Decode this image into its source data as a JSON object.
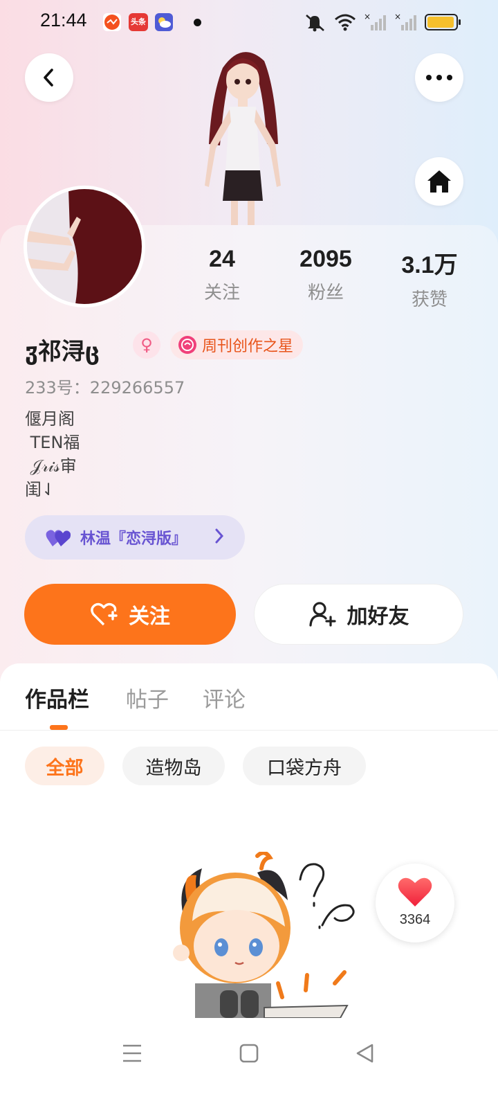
{
  "status_bar": {
    "time": "21:44",
    "notification_icons": [
      "sports-app-icon",
      "toutiao-app-icon",
      "weather-app-icon"
    ],
    "toutiao_label": "头条",
    "system_icons": [
      "mute-icon",
      "wifi-icon",
      "signal-1-icon",
      "signal-2-icon",
      "battery-icon"
    ]
  },
  "header": {
    "back_icon": "chevron-left-icon",
    "more_icon": "more-dots-icon",
    "home_icon": "home-icon"
  },
  "profile": {
    "stats": [
      {
        "value": "24",
        "label": "关注"
      },
      {
        "value": "2095",
        "label": "粉丝"
      },
      {
        "value": "3.1万",
        "label": "获赞"
      }
    ],
    "name": "ჳ祁浔ც",
    "gender_symbol": "♀",
    "badge_label": "周刊创作之星",
    "uid": "233号：229266557",
    "bio": "偃月阁\n TEN福\n 𝒥𝓇𝒾𝓈审\n闺⇃",
    "relation_pill": "林温『恋浔版』",
    "follow_label": "关注",
    "add_friend_label": "加好友"
  },
  "tabs": [
    {
      "label": "作品栏",
      "active": true
    },
    {
      "label": "帖子",
      "active": false
    },
    {
      "label": "评论",
      "active": false
    }
  ],
  "filters": [
    {
      "label": "全部",
      "active": true
    },
    {
      "label": "造物岛",
      "active": false
    },
    {
      "label": "口袋方舟",
      "active": false
    }
  ],
  "like_float": {
    "count": "3364"
  },
  "colors": {
    "accent": "#fd741b",
    "pill_text": "#6854d2",
    "badge_text": "#e8541a"
  }
}
